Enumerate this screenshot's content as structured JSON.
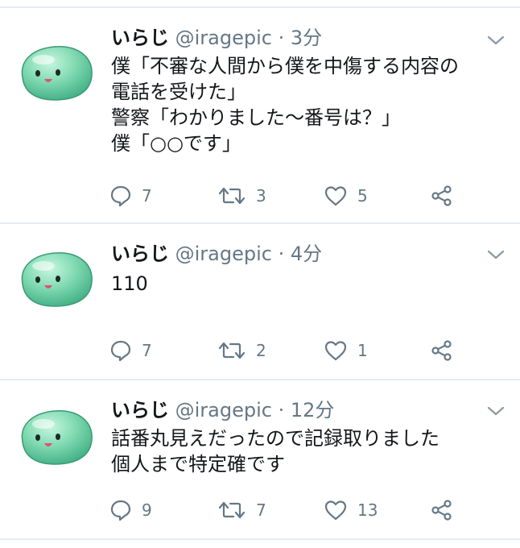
{
  "tweets": [
    {
      "name": "いらじ",
      "handle": "@iragepic",
      "time": "3分",
      "text": "僕「不審な人間から僕を中傷する内容の\n電話を受けた」\n警察「わかりました〜番号は？」\n僕「○○です」",
      "replies": "7",
      "retweets": "3",
      "likes": "5"
    },
    {
      "name": "いらじ",
      "handle": "@iragepic",
      "time": "4分",
      "text": "110",
      "replies": "7",
      "retweets": "2",
      "likes": "1"
    },
    {
      "name": "いらじ",
      "handle": "@iragepic",
      "time": "12分",
      "text": "話番丸見えだったので記録取りました\n個人まで特定確です",
      "replies": "9",
      "retweets": "7",
      "likes": "13"
    }
  ],
  "separator": " · ",
  "icons": {
    "avatar": "green-slime-avatar",
    "menu": "chevron-down-icon",
    "reply": "reply-icon",
    "retweet": "retweet-icon",
    "like": "heart-icon",
    "share": "share-icon"
  },
  "colors": {
    "icon": "#657786",
    "divider": "#e6ecf0",
    "avatar": "#7fd9b0"
  }
}
